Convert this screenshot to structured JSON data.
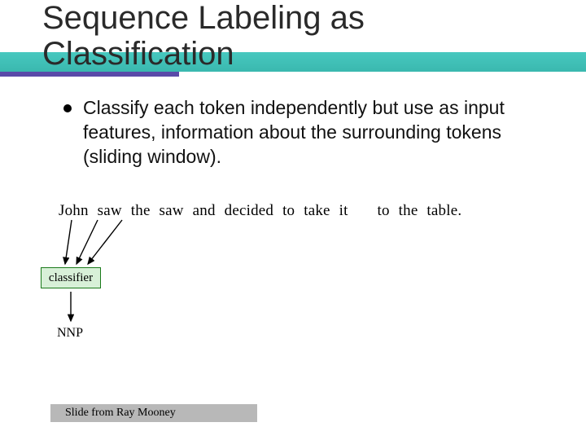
{
  "title_line1": "Sequence Labeling as",
  "title_line2": "Classification",
  "bullet": "Classify each token independently but use as input features, information about the surrounding tokens (sliding window).",
  "sentence_tokens": [
    "John",
    "saw",
    "the",
    "saw",
    "and",
    "decided",
    "to",
    "take",
    "it",
    "to",
    "the",
    "table."
  ],
  "classifier_label": "classifier",
  "output_tag": "NNP",
  "footer": "Slide from Ray Mooney"
}
